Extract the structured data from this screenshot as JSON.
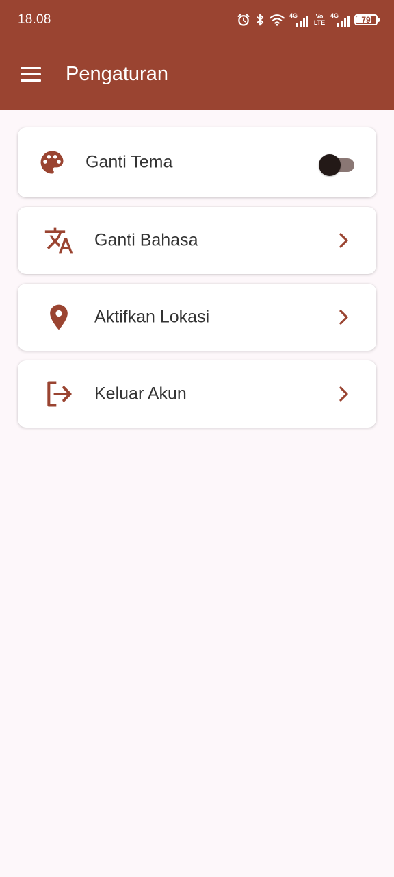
{
  "status_bar": {
    "time": "18.08",
    "network_1": "4G",
    "network_2_top": "Vo",
    "network_2_bottom": "LTE",
    "network_3": "4G",
    "battery_level": "79",
    "icons": [
      "alarm-icon",
      "bluetooth-icon",
      "wifi-icon",
      "signal-icon",
      "signal-icon",
      "battery-icon"
    ]
  },
  "app_bar": {
    "title": "Pengaturan",
    "menu_icon": "hamburger-menu-icon",
    "color": "#9a4431"
  },
  "settings": {
    "items": [
      {
        "label": "Ganti Tema",
        "icon": "palette-icon",
        "control": "toggle",
        "toggle_on": false
      },
      {
        "label": "Ganti Bahasa",
        "icon": "translate-icon",
        "control": "chevron"
      },
      {
        "label": "Aktifkan Lokasi",
        "icon": "location-pin-icon",
        "control": "chevron"
      },
      {
        "label": "Keluar Akun",
        "icon": "logout-icon",
        "control": "chevron"
      }
    ]
  },
  "colors": {
    "accent": "#9a4431",
    "background": "#fdf7fa",
    "text": "#333333"
  }
}
